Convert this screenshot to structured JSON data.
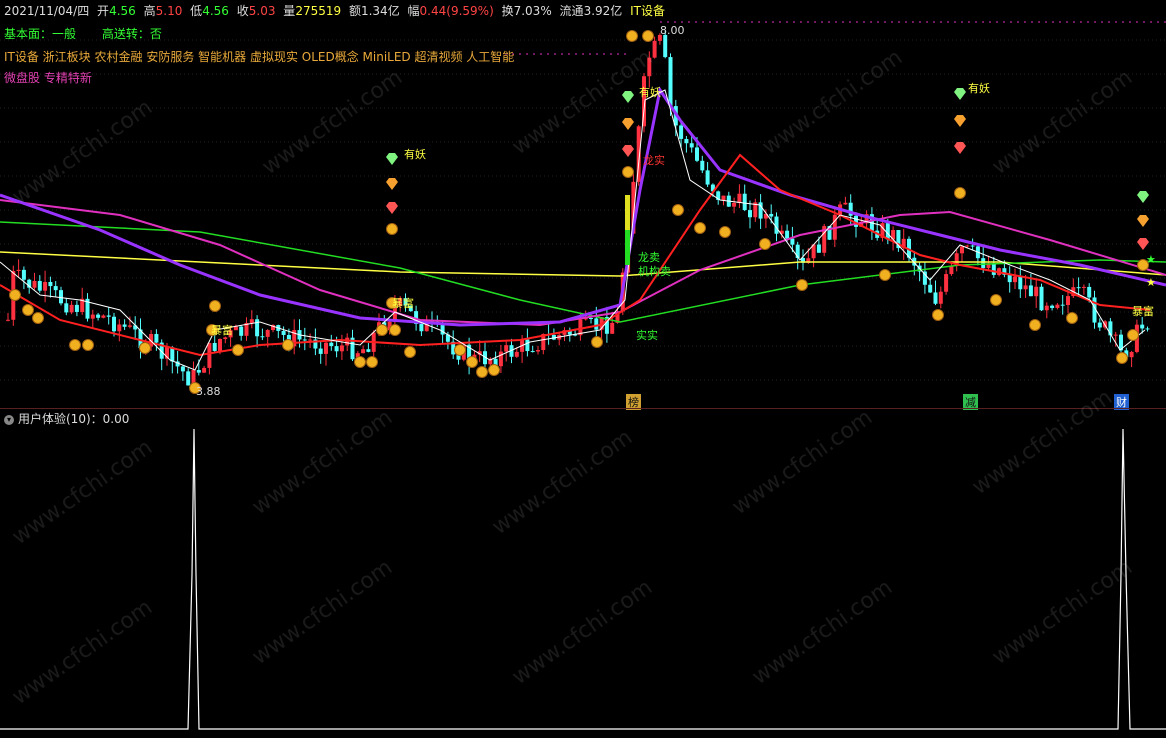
{
  "header": {
    "date": "2021/11/04/四",
    "open_label": "开",
    "open": "4.56",
    "high_label": "高",
    "high": "5.10",
    "low_label": "低",
    "low": "4.56",
    "close_label": "收",
    "close": "5.03",
    "vol_label": "量",
    "vol": "275519",
    "amount_label": "额",
    "amount": "1.34亿",
    "change_label": "幅",
    "change": "0.44(9.59%)",
    "turnover_label": "换",
    "turnover": "7.03%",
    "float_label": "流通",
    "float": "3.92亿",
    "sector": "IT设备"
  },
  "info": {
    "fundamentals_label": "基本面：",
    "fundamentals_value": "一般",
    "high_transfer_label": "高送转：",
    "high_transfer_value": "否",
    "concepts": "IT设备 浙江板块 农村金融 安防服务 智能机器 虚拟现实 OLED概念 MiniLED 超清视频 人工智能",
    "tags": "微盘股 专精特新"
  },
  "chart": {
    "peak_label": "8.00",
    "low_label": "3.88",
    "signals": {
      "youyao": "有妖",
      "baofu": "暴富",
      "longmai": "龙卖",
      "longshi": "龙实",
      "jigoumai": "机构卖",
      "shishi": "实实"
    },
    "bottom_marks": [
      "榜",
      "减",
      "财"
    ],
    "colors": {
      "up": "#ff3040",
      "down": "#54ffff",
      "ma_white": "#ffffff",
      "ma_red": "#ff2020",
      "ma_purple": "#9933ff",
      "ma_magenta": "#e030c0",
      "ma_green": "#22dd22",
      "ma_yellow": "#ffff44"
    }
  },
  "sub": {
    "title": "用户体验(10)：0.00",
    "icon": "collapse-icon"
  },
  "watermark": "www.cfchi.com"
}
